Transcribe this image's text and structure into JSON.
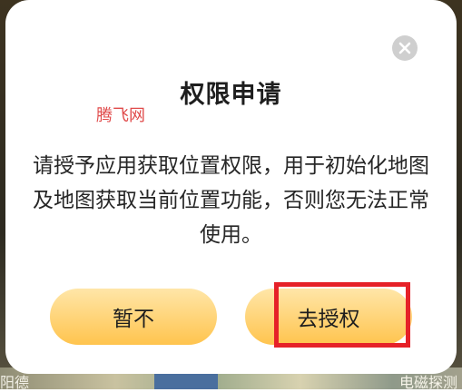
{
  "dialog": {
    "title": "权限申请",
    "watermark": "腾飞网",
    "message": "请授予应用获取位置权限，用于初始化地图及地图获取当前位置功能，否则您无法正常使用。",
    "cancel_label": "暂不",
    "authorize_label": "去授权",
    "close_icon": "close-icon"
  },
  "background": {
    "left_text": "阳德",
    "right_text": "电磁探测"
  },
  "colors": {
    "button_gradient_top": "#ffe6a8",
    "button_gradient_bottom": "#ffc44e",
    "highlight_border": "#e62128",
    "watermark": "#e04a4a",
    "close_button_bg": "#cfcfcf"
  }
}
